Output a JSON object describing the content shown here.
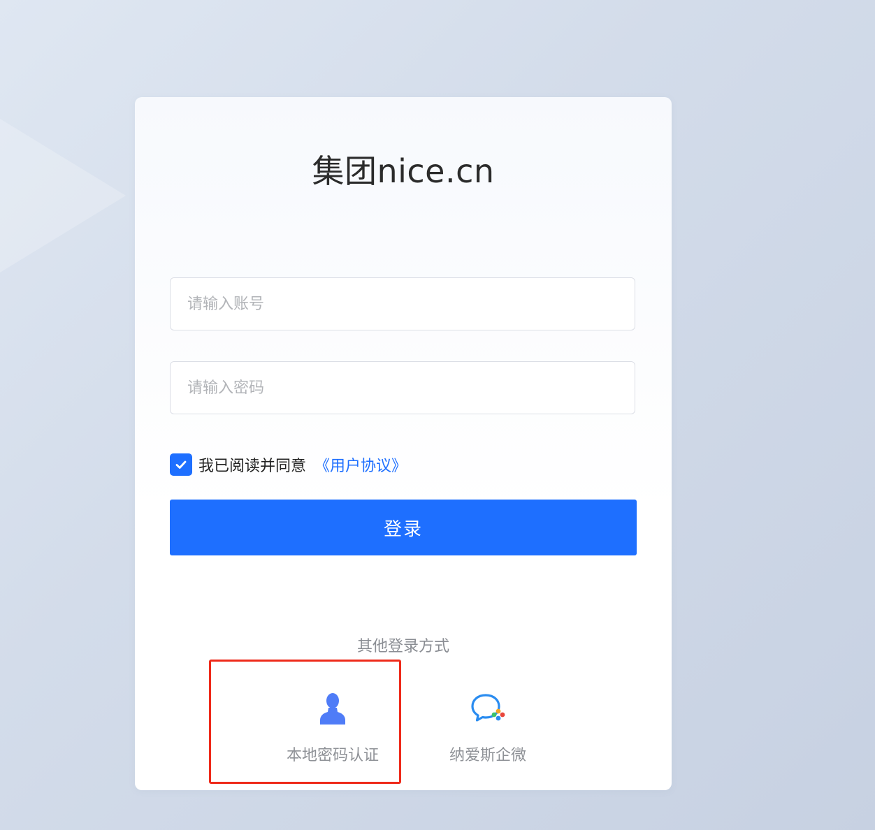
{
  "app": {
    "title": "集团nice.cn"
  },
  "form": {
    "account_placeholder": "请输入账号",
    "password_placeholder": "请输入密码",
    "agree_checked": true,
    "agree_text": "我已阅读并同意",
    "agree_link": "《用户协议》",
    "login_label": "登录"
  },
  "other_login": {
    "label": "其他登录方式",
    "methods": [
      {
        "label": "本地密码认证",
        "icon": "user-icon",
        "color": "#4f7cf7"
      },
      {
        "label": "纳爱斯企微",
        "icon": "wecom-chat-icon",
        "color": "#2a8cf0"
      }
    ]
  },
  "colors": {
    "accent": "#1e6fff",
    "highlight": "#ee2a1a"
  }
}
